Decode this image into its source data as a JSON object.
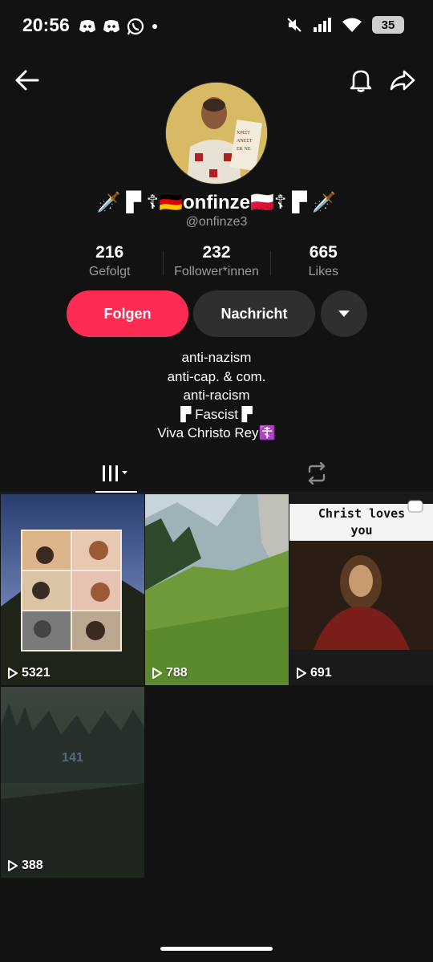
{
  "status": {
    "time": "20:56",
    "battery": "35"
  },
  "profile": {
    "display_name": "🗡️ ▛ ☦🇩🇪onfinze🇵🇱☦ ▛ 🗡️",
    "username": "@onfinze3"
  },
  "stats": [
    {
      "value": "216",
      "label": "Gefolgt"
    },
    {
      "value": "232",
      "label": "Follower*innen"
    },
    {
      "value": "665",
      "label": "Likes"
    }
  ],
  "actions": {
    "follow": "Folgen",
    "message": "Nachricht"
  },
  "bio": [
    "anti-nazism",
    "anti-cap. & com.",
    "anti-racism",
    "▛ Fascist ▛",
    "Viva Christo Rey☦️"
  ],
  "videos": [
    {
      "views": "5321"
    },
    {
      "views": "788"
    },
    {
      "views": "691",
      "caption": "Christ loves you"
    },
    {
      "views": "388",
      "overlay": "141"
    }
  ],
  "colors": {
    "background": "#121212",
    "follow": "#fe2c55",
    "button_dark": "#2f2f2f"
  }
}
